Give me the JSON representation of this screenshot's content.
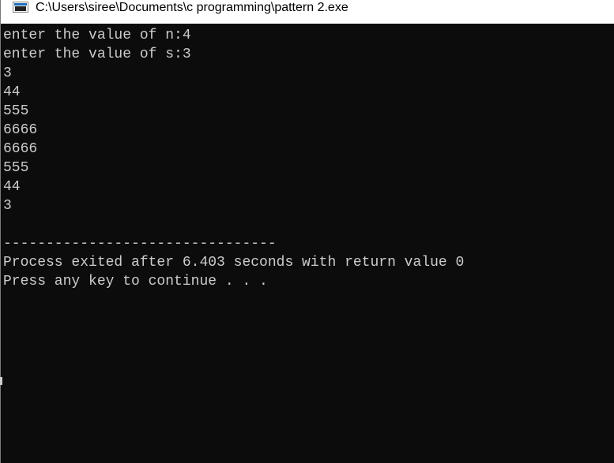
{
  "window": {
    "title": "C:\\Users\\siree\\Documents\\c programming\\pattern 2.exe",
    "icon": "console-app-icon"
  },
  "console": {
    "colors": {
      "background": "#0c0c0c",
      "text": "#cccccc"
    },
    "lines": [
      "enter the value of n:4",
      "enter the value of s:3",
      "3",
      "44",
      "555",
      "6666",
      "6666",
      "555",
      "44",
      "3",
      "",
      "--------------------------------",
      "Process exited after 6.403 seconds with return value 0",
      "Press any key to continue . . ."
    ]
  }
}
